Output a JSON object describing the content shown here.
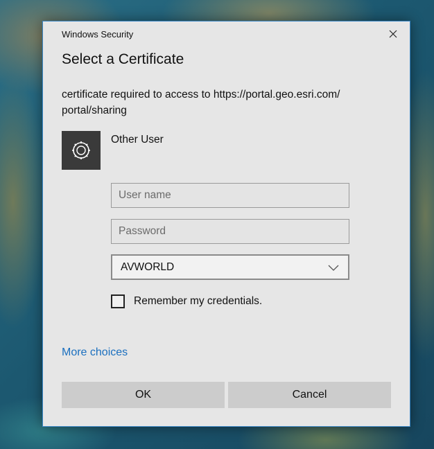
{
  "window": {
    "title": "Windows Security",
    "close_icon": "close-icon"
  },
  "dialog": {
    "heading": "Select a Certificate",
    "message": "certificate required to access to https://portal.geo.esri.com/ portal/sharing",
    "user_tile_icon": "certificate-gear-icon",
    "user_label": "Other User",
    "username_placeholder": "User name",
    "password_placeholder": "Password",
    "domain_value": "AVWORLD",
    "remember_label": "Remember my credentials.",
    "remember_checked": false,
    "more_choices": "More choices",
    "ok_label": "OK",
    "cancel_label": "Cancel"
  },
  "colors": {
    "accent_border": "#3b87c6",
    "link": "#1a6fbf",
    "dialog_bg": "#e6e6e6",
    "button_bg": "#cccccc"
  }
}
